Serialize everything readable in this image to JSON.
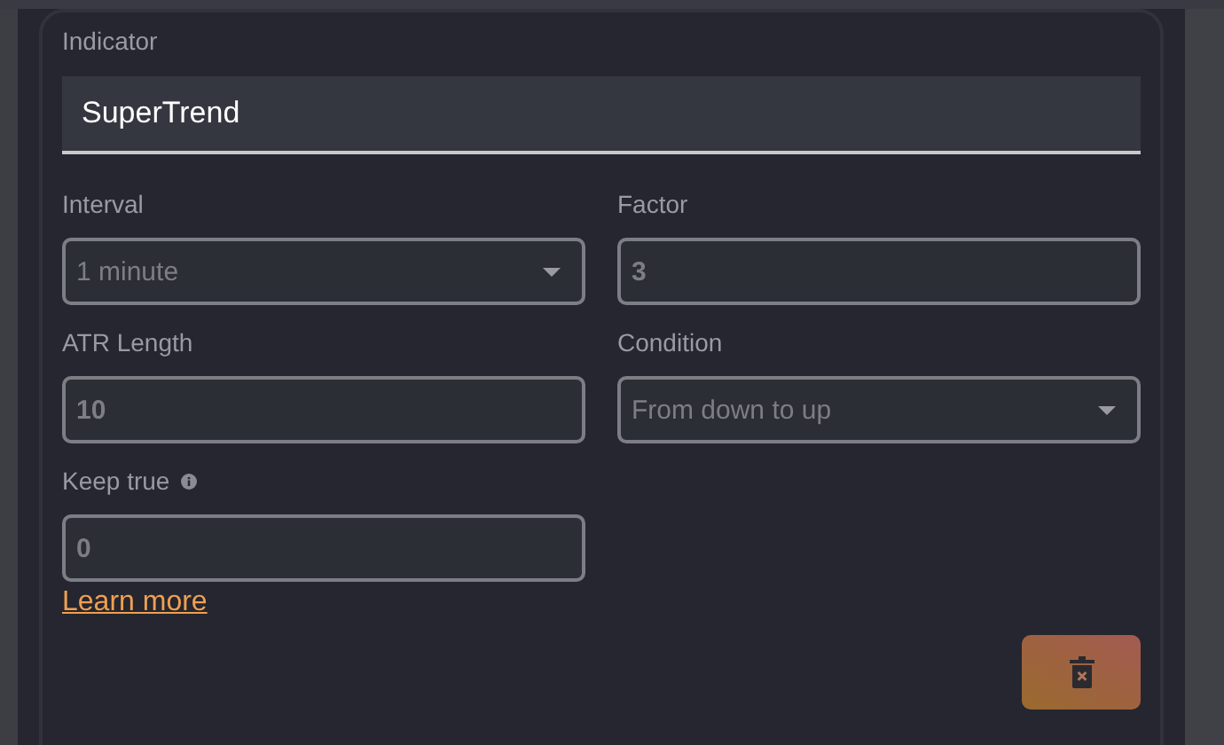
{
  "indicator": {
    "label": "Indicator",
    "value": "SuperTrend"
  },
  "fields": [
    {
      "label": "Interval",
      "value": "1 minute",
      "kind": "select"
    },
    {
      "label": "Factor",
      "value": "3",
      "kind": "input"
    },
    {
      "label": "ATR Length",
      "value": "10",
      "kind": "input"
    },
    {
      "label": "Condition",
      "value": "From down to up",
      "kind": "select"
    },
    {
      "label": "Keep true",
      "value": "0",
      "kind": "input",
      "info": true
    }
  ],
  "link": "Learn more"
}
